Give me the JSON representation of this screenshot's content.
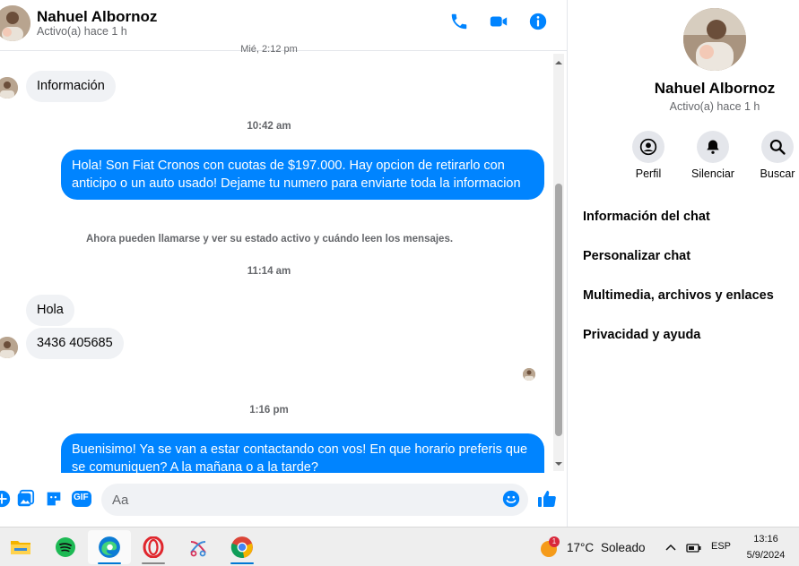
{
  "header": {
    "name": "Nahuel Albornoz",
    "status": "Activo(a) hace 1 h"
  },
  "conversation": {
    "prev_timestamp": "Mié, 2:12 pm",
    "msg_info": "Información",
    "ts1": "10:42 am",
    "msg_out1": "Hola! Son Fiat Cronos con cuotas de $197.000. Hay opcion de retirarlo con anticipo o un auto usado! Dejame tu numero para enviarte toda la informacion",
    "system_msg": "Ahora pueden llamarse y ver su estado activo y cuándo leen los mensajes.",
    "ts2": "11:14 am",
    "msg_in_hola": "Hola",
    "msg_in_number": "3436 405685",
    "ts3": "1:16 pm",
    "msg_out2": "Buenisimo! Ya se van a estar contactando con vos! En que horario preferis que se comuniquen? A la mañana o a la tarde?"
  },
  "composer": {
    "placeholder": "Aa",
    "gif_label": "GIF"
  },
  "panel": {
    "name": "Nahuel Albornoz",
    "status": "Activo(a) hace 1 h",
    "actions": {
      "profile": "Perfil",
      "mute": "Silenciar",
      "search": "Buscar"
    },
    "menu": {
      "chat_info": "Información del chat",
      "customize": "Personalizar chat",
      "media": "Multimedia, archivos y enlaces",
      "privacy": "Privacidad y ayuda"
    }
  },
  "taskbar": {
    "weather_badge": "1",
    "temperature": "17°C",
    "weather": "Soleado",
    "language": "ESP",
    "time": "13:16",
    "date": "5/9/2024"
  },
  "colors": {
    "accent": "#0084ff",
    "bubble_in": "#f0f2f5",
    "muted_text": "#65676b"
  },
  "icons": [
    "phone-icon",
    "video-camera-icon",
    "info-icon",
    "plus-circle-icon",
    "image-icon",
    "sticker-icon",
    "gif-icon",
    "emoji-icon",
    "thumbs-up-icon",
    "profile-icon",
    "bell-icon",
    "search-icon"
  ]
}
